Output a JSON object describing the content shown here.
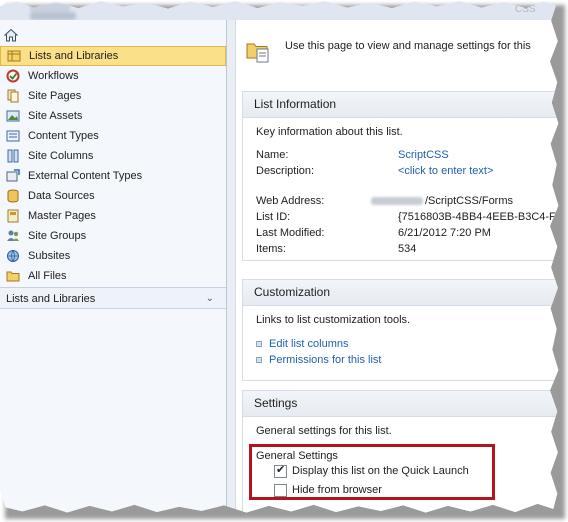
{
  "nav": {
    "items": [
      {
        "label": "Lists and Libraries",
        "icon": "lists-libraries-icon",
        "selected": true
      },
      {
        "label": "Workflows",
        "icon": "workflows-icon"
      },
      {
        "label": "Site Pages",
        "icon": "site-pages-icon"
      },
      {
        "label": "Site Assets",
        "icon": "site-assets-icon"
      },
      {
        "label": "Content Types",
        "icon": "content-types-icon"
      },
      {
        "label": "Site Columns",
        "icon": "site-columns-icon"
      },
      {
        "label": "External Content Types",
        "icon": "external-content-types-icon"
      },
      {
        "label": "Data Sources",
        "icon": "data-sources-icon"
      },
      {
        "label": "Master Pages",
        "icon": "master-pages-icon"
      },
      {
        "label": "Site Groups",
        "icon": "site-groups-icon"
      },
      {
        "label": "Subsites",
        "icon": "subsites-icon"
      },
      {
        "label": "All Files",
        "icon": "all-files-icon"
      }
    ],
    "section_label": "Lists and Libraries"
  },
  "header": {
    "description": "Use this page to view and manage settings for this"
  },
  "list_information": {
    "title": "List Information",
    "description": "Key information about this list.",
    "name_label": "Name:",
    "name_value": "ScriptCSS",
    "description_label": "Description:",
    "description_value": "<click to enter text>",
    "web_address_label": "Web Address:",
    "web_address_value": "/ScriptCSS/Forms",
    "list_id_label": "List ID:",
    "list_id_value": "{7516803B-4BB4-4EEB-B3C4-F",
    "last_modified_label": "Last Modified:",
    "last_modified_value": "6/21/2012 7:20 PM",
    "items_label": "Items:",
    "items_value": "534"
  },
  "customization": {
    "title": "Customization",
    "description": "Links to list customization tools.",
    "links": [
      "Edit list columns",
      "Permissions for this list"
    ]
  },
  "settings": {
    "title": "Settings",
    "description": "General settings for this list.",
    "group_label": "General Settings",
    "options": [
      {
        "label": "Display this list on the Quick Launch",
        "checked": true
      },
      {
        "label": "Hide from browser",
        "checked": false
      }
    ]
  },
  "colors": {
    "selected_background": "#fbe08a",
    "link": "#1f5fb3",
    "highlight_border": "#b5141f"
  }
}
